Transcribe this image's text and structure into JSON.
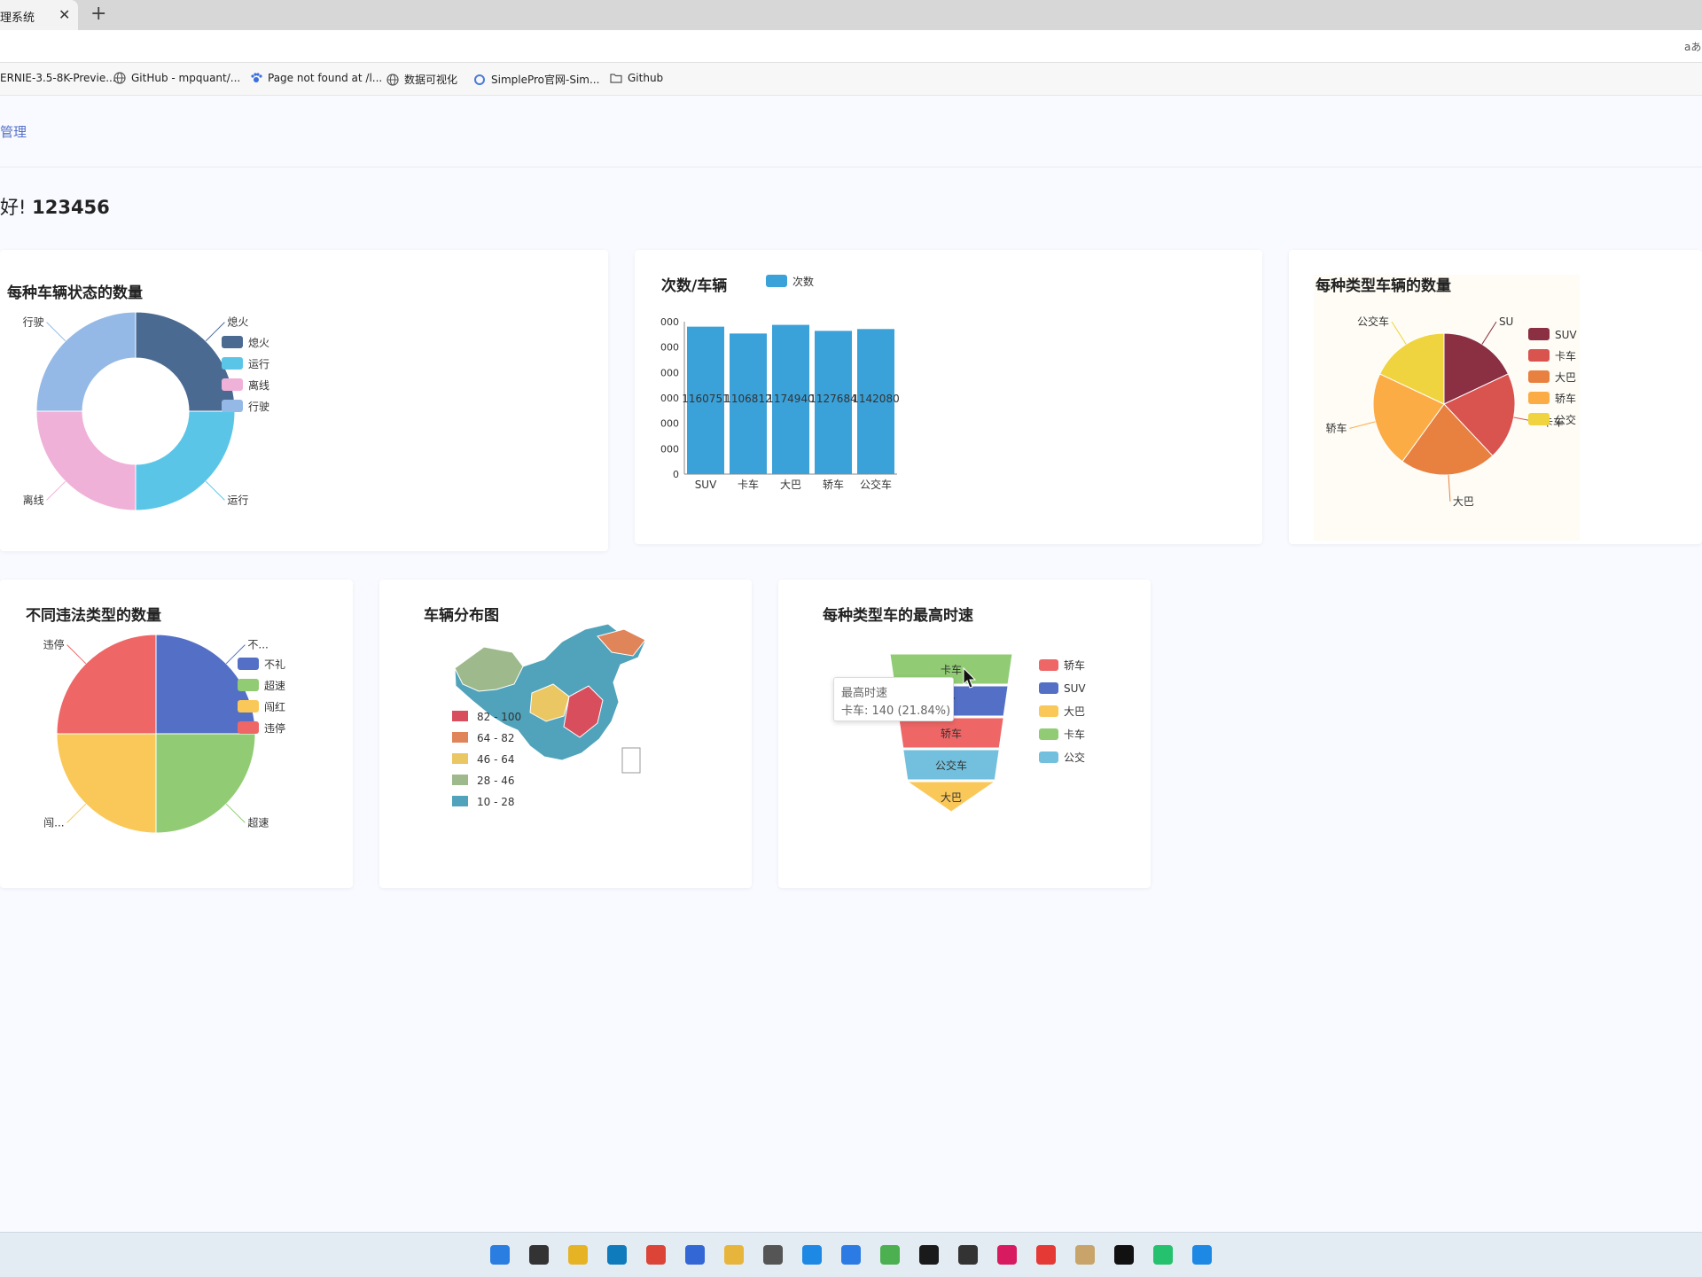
{
  "browser": {
    "tab_title": "理系统",
    "tab_close": "✕",
    "new_tab": "+",
    "read_aloud": "aあ",
    "bookmarks": [
      {
        "label": "ERNIE-3.5-8K-Previe...",
        "icon": "model-icon"
      },
      {
        "label": "GitHub - mpquant/...",
        "icon": "globe-icon"
      },
      {
        "label": "Page not found at /l...",
        "icon": "paw-icon"
      },
      {
        "label": "数据可视化",
        "icon": "globe-icon"
      },
      {
        "label": "SimplePro官网-Sim...",
        "icon": "simplepro-icon"
      },
      {
        "label": "Github",
        "icon": "folder-icon"
      }
    ]
  },
  "page": {
    "nav_label": "管理",
    "greeting_prefix": "好!",
    "username": "123456"
  },
  "cards": {
    "status": {
      "title": "每种车辆状态的数量"
    },
    "count": {
      "title": "次数/车辆"
    },
    "type": {
      "title": "每种类型车辆的数量"
    },
    "violation": {
      "title": "不同违法类型的数量"
    },
    "map": {
      "title": "车辆分布图"
    },
    "speed": {
      "title": "每种类型车的最高时速"
    }
  },
  "tooltip": {
    "title": "最高时速",
    "body": "卡车: 140 (21.84%)"
  },
  "colors": {
    "accent": "#5470c6",
    "bar": "#3aa1d9"
  },
  "chart_data": [
    {
      "type": "pie",
      "variant": "donut",
      "title": "每种车辆状态的数量",
      "legend_position": "right",
      "labels": [
        "熄火",
        "运行",
        "离线",
        "行驶"
      ],
      "values": [
        25,
        25,
        25,
        25
      ],
      "colors": [
        "#4a6a92",
        "#5bc5e8",
        "#f0b1d8",
        "#94b9e6"
      ]
    },
    {
      "type": "bar",
      "title": "次数/车辆",
      "legend": [
        "次数"
      ],
      "legend_position": "top",
      "categories": [
        "SUV",
        "卡车",
        "大巴",
        "轿车",
        "公交车"
      ],
      "series": [
        {
          "name": "次数",
          "values": [
            1160751,
            1106812,
            1174940,
            1127684,
            1142080
          ]
        }
      ],
      "yticks": [
        "0",
        "000",
        "000",
        "000",
        "000",
        "000",
        "000"
      ],
      "data_labels": [
        "1160751",
        "1106812",
        "1174940",
        "1127684",
        "1142080"
      ],
      "ylim": [
        0,
        1200000
      ],
      "color": "#3aa1d9"
    },
    {
      "type": "pie",
      "title": "每种类型车辆的数量",
      "legend_position": "right",
      "labels": [
        "SUV",
        "卡车",
        "大巴",
        "轿车",
        "公交车"
      ],
      "legend_labels": [
        "SUV",
        "卡车",
        "大巴",
        "轿车",
        "公交"
      ],
      "slice_labels": [
        "SU",
        "卡车",
        "大巴",
        "轿车",
        "公交车"
      ],
      "values": [
        18,
        20,
        22,
        22,
        18
      ],
      "colors": [
        "#8b2f43",
        "#d9534f",
        "#e8803f",
        "#fcac45",
        "#efd43f"
      ]
    },
    {
      "type": "pie",
      "title": "不同违法类型的数量",
      "legend_position": "right",
      "labels": [
        "不礼",
        "超速",
        "闯红",
        "违停"
      ],
      "slice_labels": [
        "不...",
        "超速",
        "闯...",
        "违停"
      ],
      "values": [
        25,
        25,
        25,
        25
      ],
      "colors": [
        "#5470c6",
        "#91cc75",
        "#fac858",
        "#ee6666"
      ]
    },
    {
      "type": "map",
      "title": "车辆分布图",
      "legend_position": "bottom-left",
      "ranges": [
        "82 - 100",
        "64 - 82",
        "46 - 64",
        "28 - 46",
        "10 - 28"
      ],
      "colors": [
        "#d94e5d",
        "#e0845a",
        "#eac763",
        "#9eb98c",
        "#50a3ba"
      ]
    },
    {
      "type": "funnel",
      "title": "每种类型车的最高时速",
      "series_name": "最高时速",
      "legend_position": "right",
      "labels": [
        "卡车",
        "SUV",
        "轿车",
        "公交车",
        "大巴"
      ],
      "slice_labels": [
        "卡车",
        "V",
        "轿车",
        "公交车",
        "大巴"
      ],
      "values": [
        140,
        130,
        120,
        110,
        100
      ],
      "colors": [
        "#91cc75",
        "#5470c6",
        "#ee6666",
        "#73c0de",
        "#fac858"
      ],
      "legend": [
        {
          "label": "轿车",
          "color": "#ee6666"
        },
        {
          "label": "SUV",
          "color": "#5470c6"
        },
        {
          "label": "大巴",
          "color": "#fac858"
        },
        {
          "label": "卡车",
          "color": "#91cc75"
        },
        {
          "label": "公交",
          "color": "#73c0de"
        }
      ]
    }
  ]
}
